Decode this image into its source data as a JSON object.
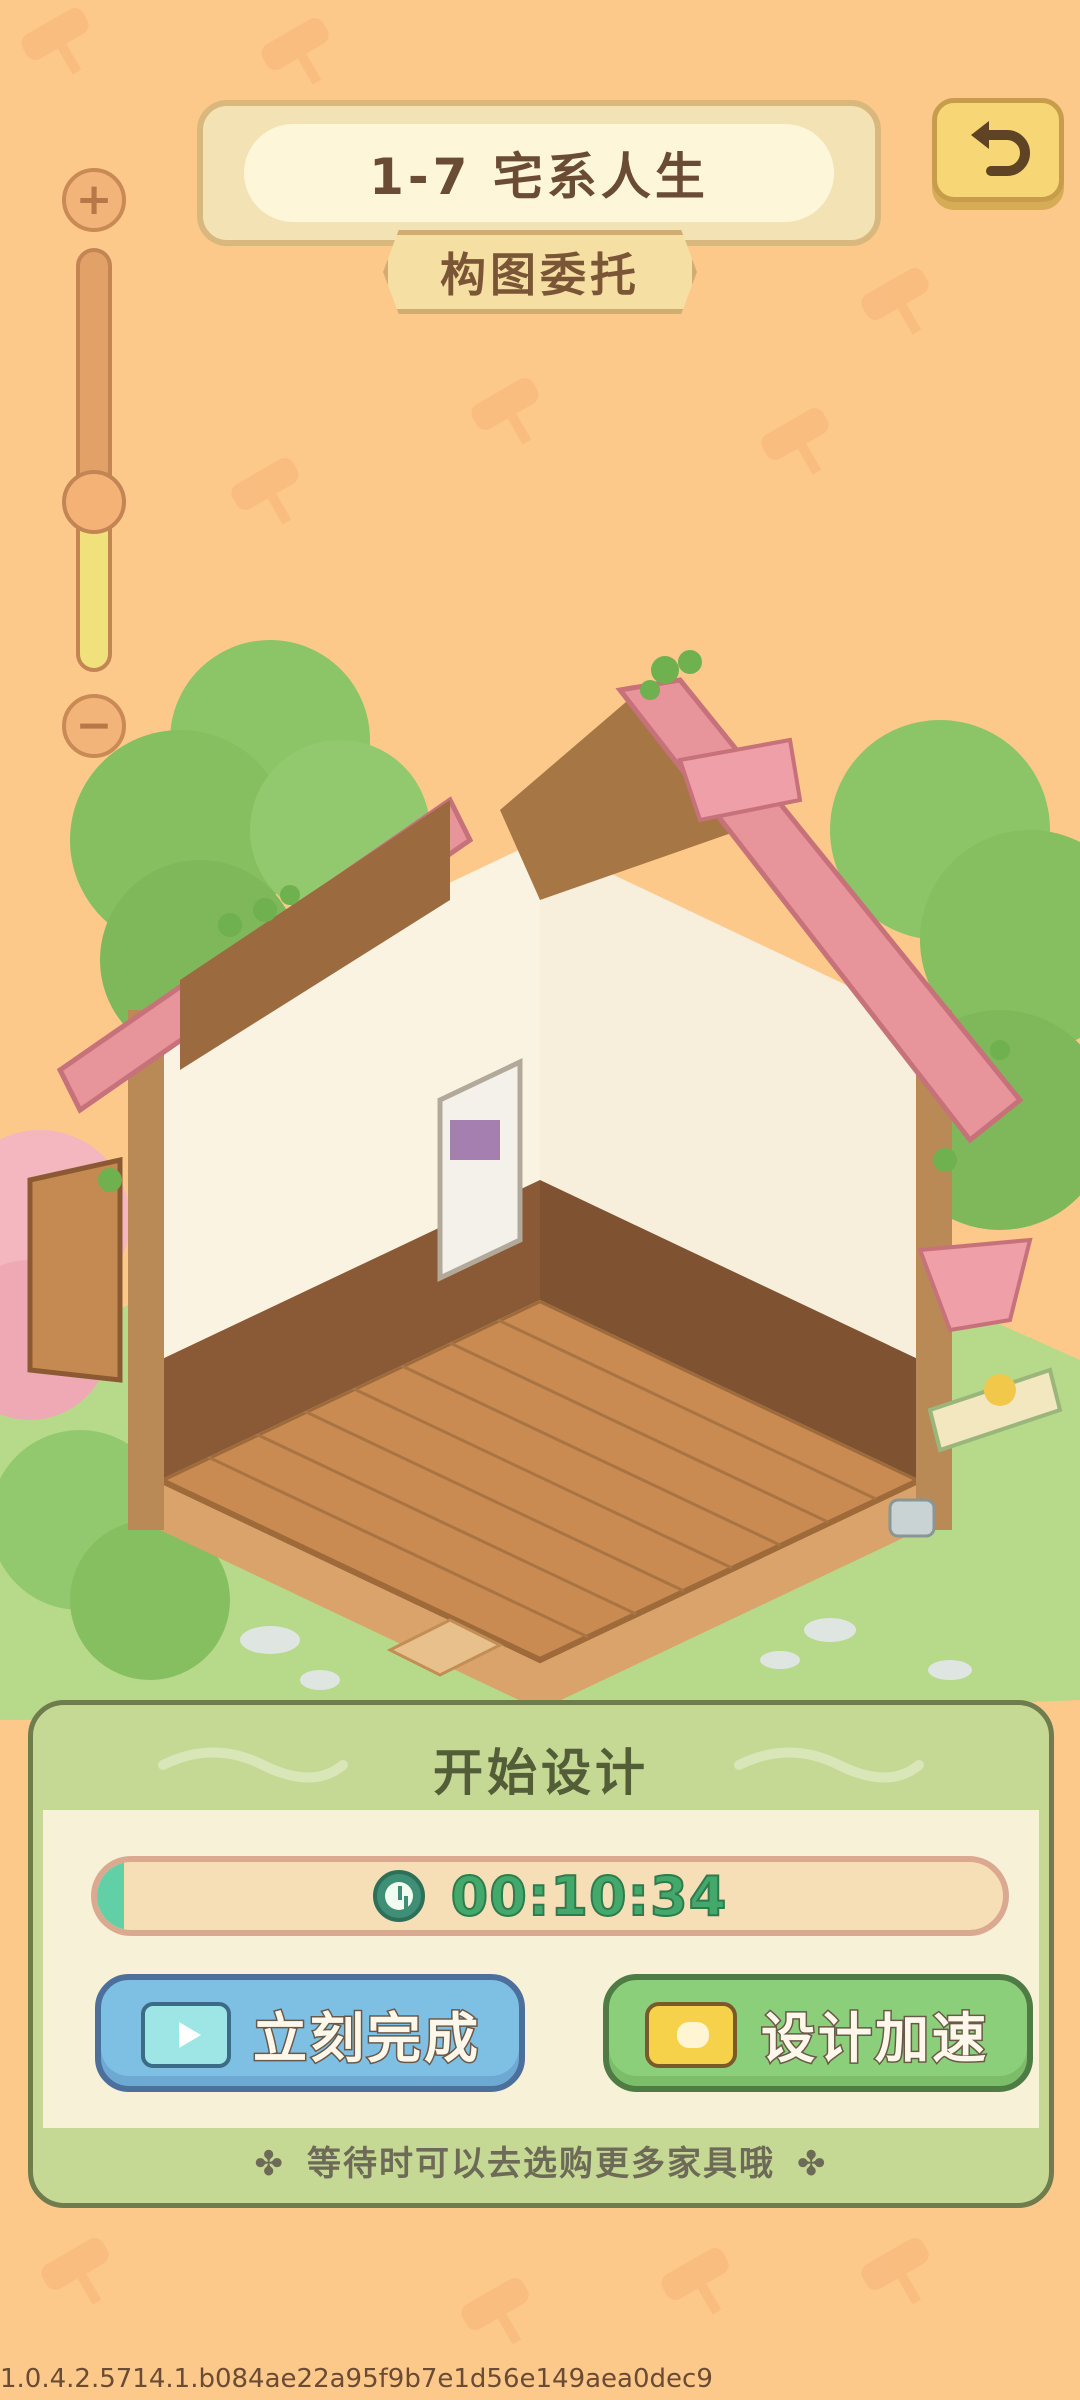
{
  "level": {
    "title": "1-7 宅系人生",
    "subtitle": "构图委托"
  },
  "zoom": {
    "level_fraction": 0.4,
    "zoom_in_icon": "plus-icon",
    "zoom_out_icon": "minus-icon"
  },
  "back": {
    "icon": "undo-arrow-icon"
  },
  "panel": {
    "title": "开始设计",
    "timer": "00:10:34",
    "progress_fraction": 0.02,
    "instant_label": "立刻完成",
    "speed_label": "设计加速",
    "hint": "等待时可以去选购更多家具哦"
  },
  "version": "1.0.4.2.5714.1.b084ae22a95f9b7e1d56e149aea0dec9",
  "colors": {
    "background": "#fdc98a",
    "roof": "#e8949b",
    "panel_green": "#c5d994",
    "timer_green": "#43a96a"
  }
}
